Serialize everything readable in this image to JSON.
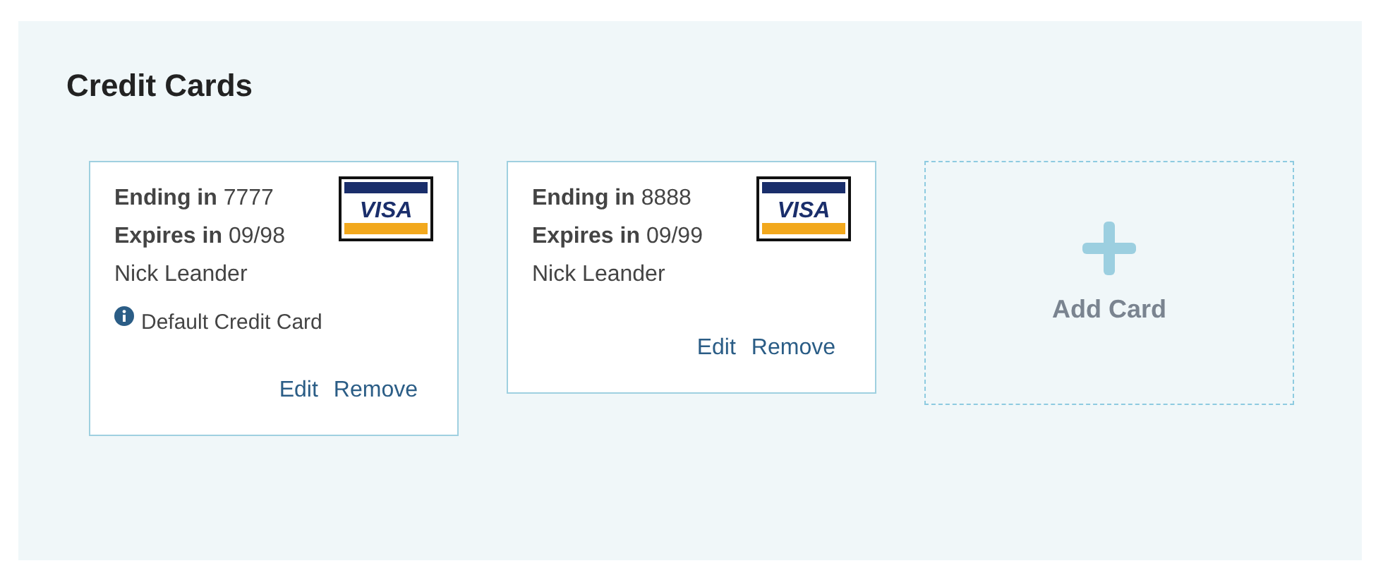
{
  "section": {
    "title": "Credit Cards"
  },
  "cards": [
    {
      "brand": "VISA",
      "ending_label": "Ending in",
      "ending": "7777",
      "expires_label": "Expires in",
      "expires": "09/98",
      "holder": "Nick Leander",
      "default": true,
      "default_note": "Default Credit Card",
      "actions": [
        "Edit",
        "Remove"
      ]
    },
    {
      "brand": "VISA",
      "ending_label": "Ending in",
      "ending": "8888",
      "expires_label": "Expires in",
      "expires": "09/99",
      "holder": "Nick Leander",
      "default": false,
      "actions": [
        "Edit",
        "Remove"
      ]
    }
  ],
  "add_card": {
    "label": "Add Card"
  }
}
